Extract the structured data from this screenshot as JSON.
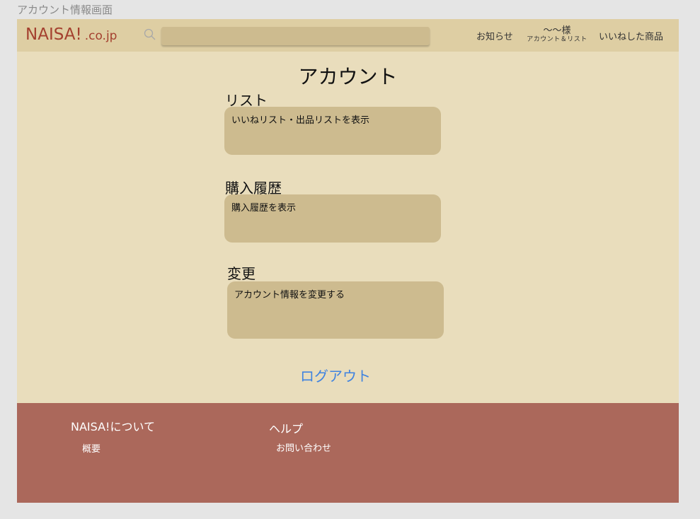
{
  "artboard": {
    "title": "アカウント情報画面"
  },
  "header": {
    "logo_main": "NAISA!",
    "logo_tld": ".co.jp",
    "search": {
      "value": "",
      "placeholder": ""
    },
    "nav": {
      "news": "お知らせ",
      "account_name": "〜〜様",
      "account_sub": "アカウント＆リスト",
      "liked": "いいねした商品"
    }
  },
  "main": {
    "title": "アカウント",
    "sections": [
      {
        "heading": "リスト",
        "card_text": "いいねリスト・出品リストを表示"
      },
      {
        "heading": "購入履歴",
        "card_text": "購入履歴を表示"
      },
      {
        "heading": "変更",
        "card_text": "アカウント情報を変更する"
      }
    ],
    "logout_label": "ログアウト"
  },
  "footer": {
    "about_heading": "NAISA!について",
    "about_link": "概要",
    "help_heading": "ヘルプ",
    "help_link": "お問い合わせ"
  },
  "colors": {
    "header_bg": "#decea3",
    "page_bg": "#e9ddbc",
    "card_bg": "#cdbb8f",
    "brand_red": "#a4402f",
    "footer_bg": "#ab685b",
    "link_blue": "#3f83e0"
  }
}
